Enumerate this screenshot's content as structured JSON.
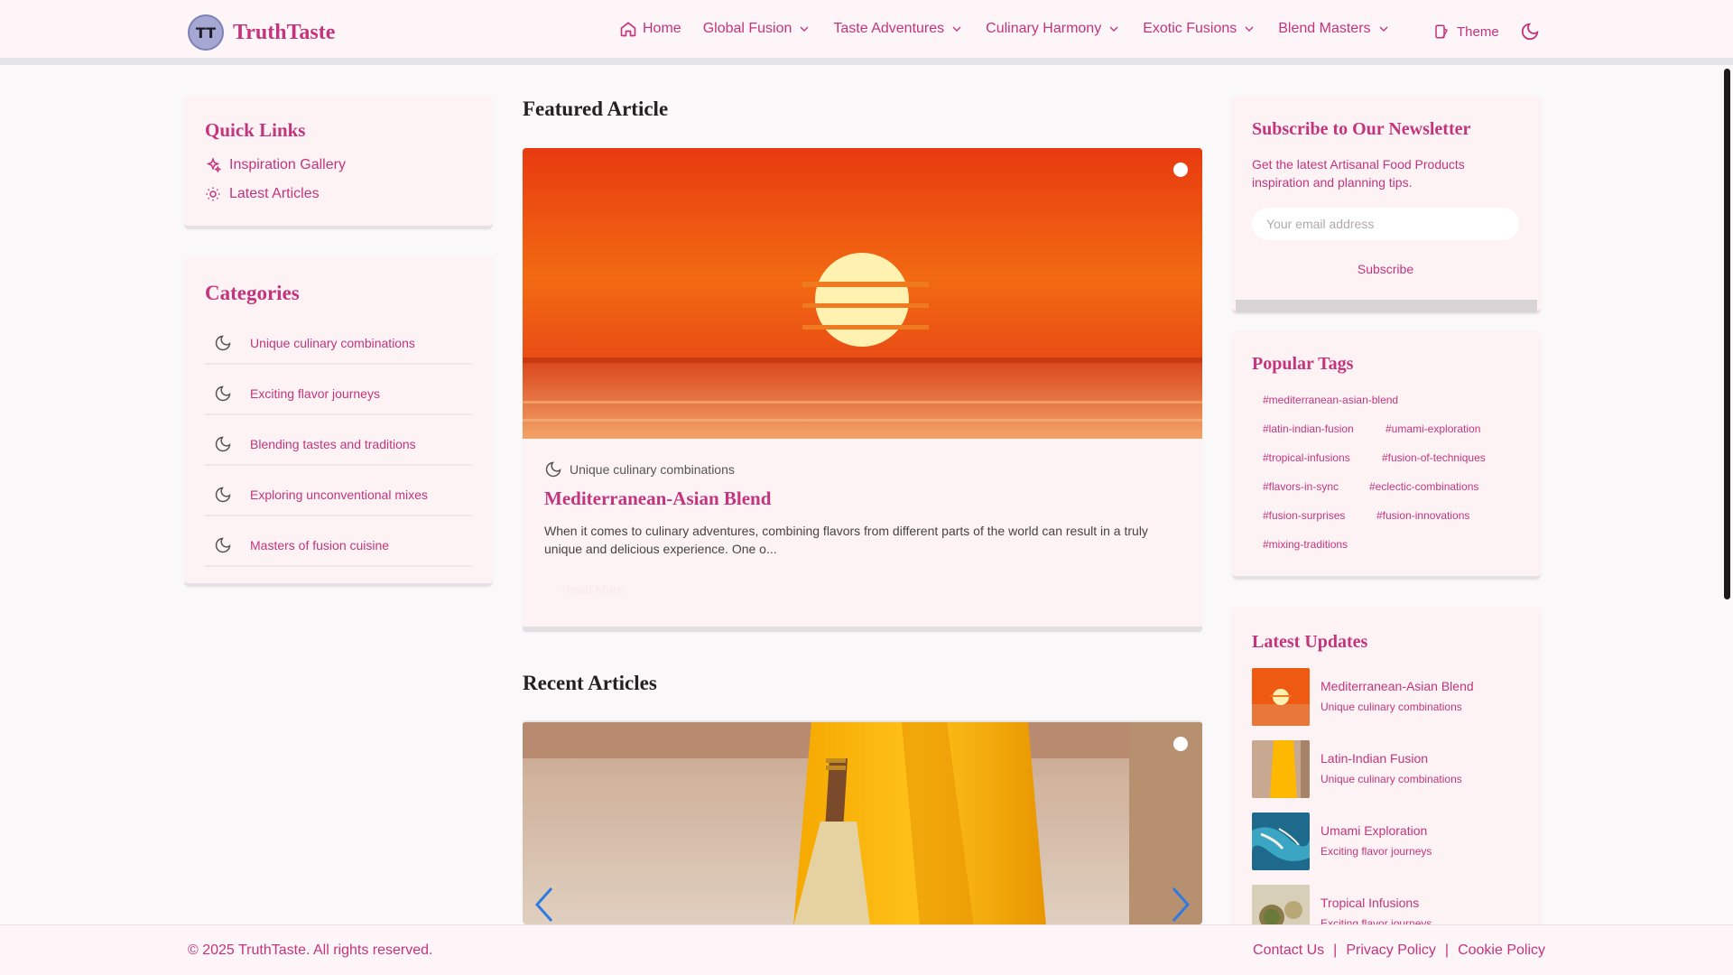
{
  "header": {
    "logo_initials": "TT",
    "brand": "TruthTaste",
    "nav": [
      {
        "label": "Home",
        "icon": "home-icon"
      },
      {
        "label": "Global Fusion",
        "icon": "chevron-down-icon"
      },
      {
        "label": "Taste Adventures",
        "icon": "chevron-down-icon"
      },
      {
        "label": "Culinary Harmony",
        "icon": "chevron-down-icon"
      },
      {
        "label": "Exotic Fusions",
        "icon": "chevron-down-icon"
      },
      {
        "label": "Blend Masters",
        "icon": "chevron-down-icon"
      }
    ],
    "theme_label": "Theme"
  },
  "quick_links": {
    "title": "Quick Links",
    "items": [
      {
        "label": "Inspiration Gallery",
        "icon": "sparkles-icon"
      },
      {
        "label": "Latest Articles",
        "icon": "sun-icon"
      }
    ]
  },
  "categories": {
    "title": "Categories",
    "items": [
      "Unique culinary combinations",
      "Exciting flavor journeys",
      "Blending tastes and traditions",
      "Exploring unconventional mixes",
      "Masters of fusion cuisine"
    ]
  },
  "featured": {
    "section_title": "Featured Article",
    "category": "Unique culinary combinations",
    "title": "Mediterranean-Asian Blend",
    "excerpt": "When it comes to culinary adventures, combining flavors from different parts of the world can result in a truly unique and delicious experience. One o...",
    "read_more": "Read More"
  },
  "recent": {
    "section_title": "Recent Articles"
  },
  "newsletter": {
    "title": "Subscribe to Our Newsletter",
    "description": "Get the latest Artisanal Food Products inspiration and planning tips.",
    "email_placeholder": "Your email address",
    "button": "Subscribe"
  },
  "tags": {
    "title": "Popular Tags",
    "items": [
      "#mediterranean-asian-blend",
      "#latin-indian-fusion",
      "#umami-exploration",
      "#tropical-infusions",
      "#fusion-of-techniques",
      "#flavors-in-sync",
      "#eclectic-combinations",
      "#fusion-surprises",
      "#fusion-innovations",
      "#mixing-traditions"
    ]
  },
  "updates": {
    "title": "Latest Updates",
    "items": [
      {
        "title": "Mediterranean-Asian Blend",
        "category": "Unique culinary combinations"
      },
      {
        "title": "Latin-Indian Fusion",
        "category": "Unique culinary combinations"
      },
      {
        "title": "Umami Exploration",
        "category": "Exciting flavor journeys"
      },
      {
        "title": "Tropical Infusions",
        "category": "Exciting flavor journeys"
      }
    ]
  },
  "footer": {
    "copyright": "© 2025 TruthTaste. All rights reserved.",
    "links": [
      "Contact Us",
      "Privacy Policy",
      "Cookie Policy"
    ],
    "separator": "|"
  },
  "colors": {
    "accent": "#c4347c",
    "card_bg": "#fdf3f5"
  }
}
